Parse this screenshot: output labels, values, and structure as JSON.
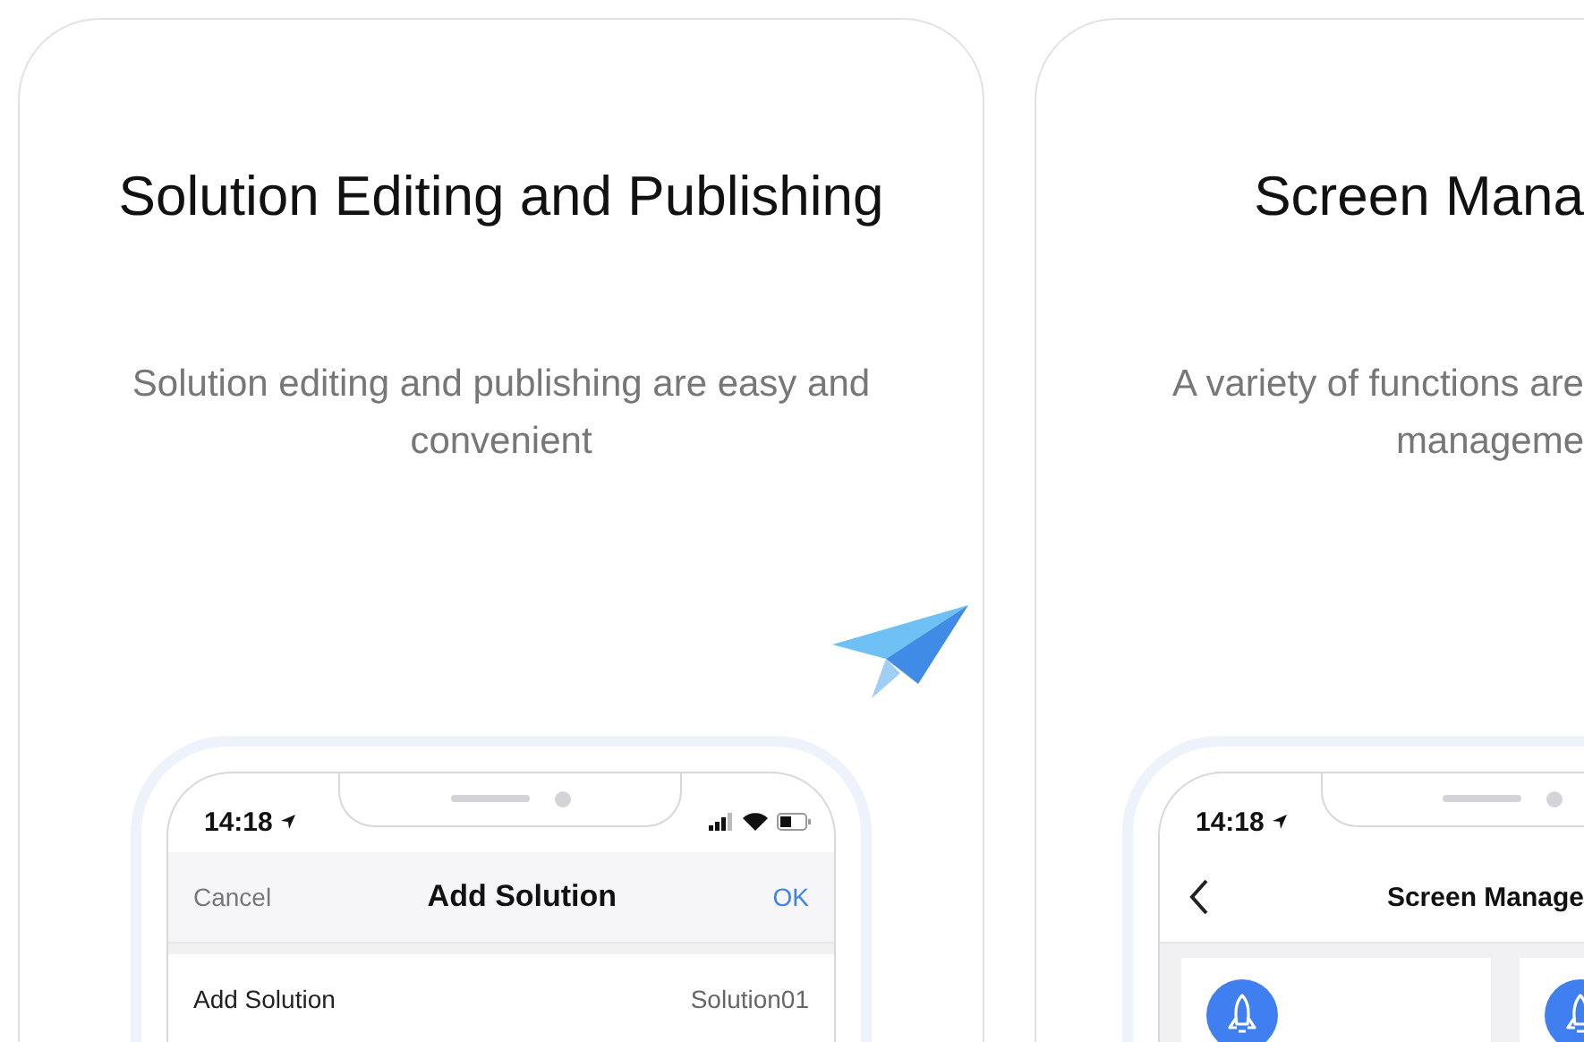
{
  "panels": [
    {
      "title": "Solution Editing and Publishing",
      "subtitle_lines": [
        "Solution editing and publishing are easy and",
        "convenient"
      ],
      "plane": true,
      "phone": {
        "kind": "form",
        "time": "14:18",
        "status_icons": true,
        "nav": {
          "left": "Cancel",
          "title": "Add Solution",
          "right": "OK"
        },
        "rows": [
          {
            "label": "Add Solution",
            "value": "Solution01"
          }
        ]
      }
    },
    {
      "title": "Screen Mana",
      "subtitle_lines": [
        "A variety of functions are",
        "manageme"
      ],
      "plane": false,
      "phone": {
        "kind": "grid",
        "time": "14:18",
        "status_icons": false,
        "nav": {
          "title": "Screen Manage"
        }
      }
    }
  ]
}
